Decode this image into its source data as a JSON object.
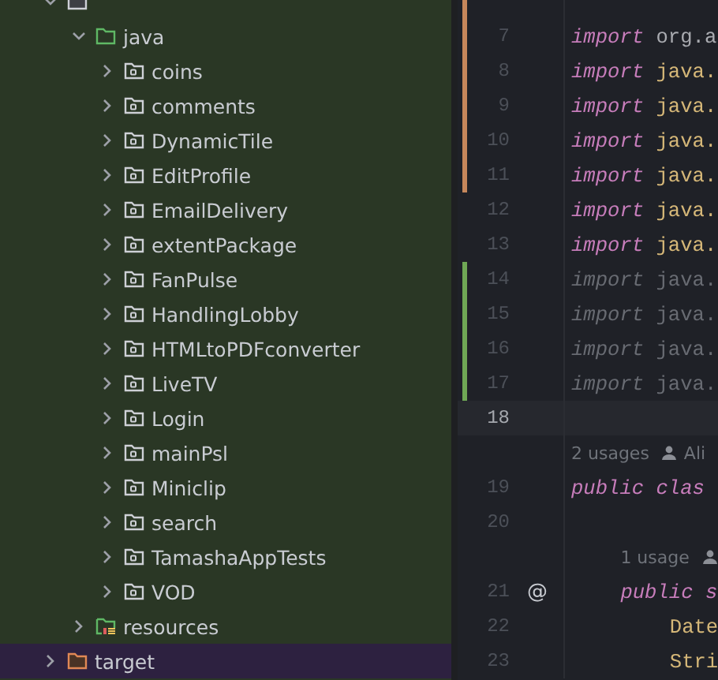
{
  "project_tree": {
    "items": [
      {
        "kind": "module",
        "expanded": true,
        "selected": false,
        "children": [
          {
            "label": "java",
            "kind": "source-root",
            "expanded": true,
            "selected": false,
            "children": [
              {
                "label": "coins",
                "kind": "package",
                "expanded": false,
                "selected": false
              },
              {
                "label": "comments",
                "kind": "package",
                "expanded": false,
                "selected": false
              },
              {
                "label": "DynamicTile",
                "kind": "package",
                "expanded": false,
                "selected": false
              },
              {
                "label": "EditProfile",
                "kind": "package",
                "expanded": false,
                "selected": false
              },
              {
                "label": "EmailDelivery",
                "kind": "package",
                "expanded": false,
                "selected": false
              },
              {
                "label": "extentPackage",
                "kind": "package",
                "expanded": false,
                "selected": false
              },
              {
                "label": "FanPulse",
                "kind": "package",
                "expanded": false,
                "selected": false
              },
              {
                "label": "HandlingLobby",
                "kind": "package",
                "expanded": false,
                "selected": false
              },
              {
                "label": "HTMLtoPDFconverter",
                "kind": "package",
                "expanded": false,
                "selected": false
              },
              {
                "label": "LiveTV",
                "kind": "package",
                "expanded": false,
                "selected": false
              },
              {
                "label": "Login",
                "kind": "package",
                "expanded": false,
                "selected": false
              },
              {
                "label": "mainPsl",
                "kind": "package",
                "expanded": false,
                "selected": false
              },
              {
                "label": "Miniclip",
                "kind": "package",
                "expanded": false,
                "selected": false
              },
              {
                "label": "search",
                "kind": "package",
                "expanded": false,
                "selected": false
              },
              {
                "label": "TamashaAppTests",
                "kind": "package",
                "expanded": false,
                "selected": false
              },
              {
                "label": "VOD",
                "kind": "package",
                "expanded": false,
                "selected": false
              }
            ]
          },
          {
            "label": "resources",
            "kind": "resources-root",
            "expanded": false,
            "selected": false
          }
        ]
      },
      {
        "label": "target",
        "kind": "excluded",
        "expanded": false,
        "selected": true
      }
    ]
  },
  "editor": {
    "lines": [
      {
        "kind": "code",
        "modified": true,
        "added": false
      },
      {
        "kind": "code",
        "number": "7",
        "modified": true,
        "added": false,
        "unused": false,
        "current": false,
        "tokens": [
          {
            "text": "import",
            "kind": "keyword"
          },
          {
            "text": "org.a",
            "kind": "plain"
          }
        ]
      },
      {
        "kind": "code",
        "number": "8",
        "modified": true,
        "added": false,
        "unused": false,
        "current": false,
        "tokens": [
          {
            "text": "import",
            "kind": "keyword"
          },
          {
            "text": "java.",
            "kind": "package"
          }
        ]
      },
      {
        "kind": "code",
        "number": "9",
        "modified": true,
        "added": false,
        "unused": false,
        "current": false,
        "tokens": [
          {
            "text": "import",
            "kind": "keyword"
          },
          {
            "text": "java.",
            "kind": "package"
          }
        ]
      },
      {
        "kind": "code",
        "number": "10",
        "modified": true,
        "added": false,
        "unused": false,
        "current": false,
        "tokens": [
          {
            "text": "import",
            "kind": "keyword"
          },
          {
            "text": "java.",
            "kind": "package"
          }
        ]
      },
      {
        "kind": "code",
        "number": "11",
        "modified": true,
        "added": false,
        "unused": false,
        "current": false,
        "tokens": [
          {
            "text": "import",
            "kind": "keyword"
          },
          {
            "text": "java.",
            "kind": "package"
          }
        ]
      },
      {
        "kind": "code",
        "number": "12",
        "modified": false,
        "added": false,
        "unused": false,
        "current": false,
        "tokens": [
          {
            "text": "import",
            "kind": "keyword"
          },
          {
            "text": "java.",
            "kind": "package"
          }
        ]
      },
      {
        "kind": "code",
        "number": "13",
        "modified": false,
        "added": false,
        "unused": false,
        "current": false,
        "tokens": [
          {
            "text": "import",
            "kind": "keyword"
          },
          {
            "text": "java.",
            "kind": "package"
          }
        ]
      },
      {
        "kind": "code",
        "number": "14",
        "modified": false,
        "added": true,
        "unused": true,
        "current": false,
        "tokens": [
          {
            "text": "import",
            "kind": "keyword"
          },
          {
            "text": "java.",
            "kind": "package"
          }
        ]
      },
      {
        "kind": "code",
        "number": "15",
        "modified": false,
        "added": true,
        "unused": true,
        "current": false,
        "tokens": [
          {
            "text": "import",
            "kind": "keyword"
          },
          {
            "text": "java.",
            "kind": "package"
          }
        ]
      },
      {
        "kind": "code",
        "number": "16",
        "modified": false,
        "added": true,
        "unused": true,
        "current": false,
        "tokens": [
          {
            "text": "import",
            "kind": "keyword"
          },
          {
            "text": "java.",
            "kind": "package"
          }
        ]
      },
      {
        "kind": "code",
        "number": "17",
        "modified": false,
        "added": true,
        "unused": true,
        "current": false,
        "tokens": [
          {
            "text": "import",
            "kind": "keyword"
          },
          {
            "text": "java.",
            "kind": "package"
          }
        ]
      },
      {
        "kind": "code",
        "number": "18",
        "modified": false,
        "added": false,
        "current": true
      },
      {
        "kind": "hint",
        "usages": "2 usages",
        "author": "Ali"
      },
      {
        "kind": "code",
        "number": "19",
        "modified": false,
        "added": false,
        "unused": false,
        "current": false,
        "tokens": [
          {
            "text": "public clas",
            "kind": "keyword"
          }
        ],
        "children": [
          {
            "kind": "code",
            "number": "20",
            "modified": false,
            "added": false,
            "current": false
          },
          {
            "kind": "hint",
            "usages": "1 usage"
          },
          {
            "kind": "code",
            "number": "21",
            "modified": false,
            "added": false,
            "unused": false,
            "current": false,
            "gutter_mark": "@",
            "tokens": [
              {
                "text": "public s",
                "kind": "keyword"
              }
            ],
            "children": [
              {
                "kind": "code",
                "number": "22",
                "modified": false,
                "added": false,
                "unused": false,
                "current": false,
                "tokens": [
                  {
                    "text": "Date",
                    "kind": "class"
                  }
                ]
              },
              {
                "kind": "code",
                "number": "23",
                "modified": false,
                "added": false,
                "unused": false,
                "current": false,
                "tokens": [
                  {
                    "text": "Stri",
                    "kind": "class"
                  }
                ]
              }
            ]
          }
        ]
      }
    ]
  }
}
